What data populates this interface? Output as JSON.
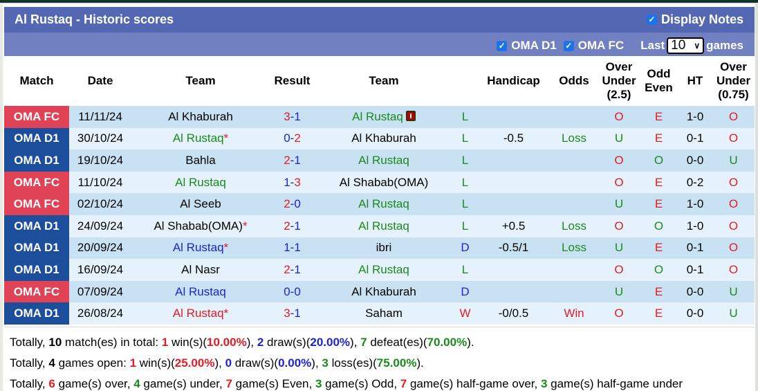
{
  "header": {
    "title": "Al Rustaq - Historic scores",
    "display_notes_label": "Display Notes",
    "display_notes_checked": true
  },
  "filters": {
    "league1_label": "OMA D1",
    "league1_checked": true,
    "league2_label": "OMA FC",
    "league2_checked": true,
    "last_label": "Last",
    "last_value": "10",
    "games_label": "games"
  },
  "columns": [
    "Match",
    "Date",
    "Team",
    "Result",
    "Team",
    "",
    "Handicap",
    "Odds",
    "Over Under (2.5)",
    "Odd Even",
    "HT",
    "Over Under (0.75)"
  ],
  "column_lines": {
    "ou25": [
      "Over",
      "Under",
      "(2.5)"
    ],
    "oe": [
      "Odd",
      "Even"
    ],
    "ou075": [
      "Over",
      "Under",
      "(0.75)"
    ]
  },
  "colors": {
    "title_bar": "#5467b2",
    "filter_bar": "#7080c0",
    "oma_fc": "#df4355",
    "oma_d1": "#1c4e9c",
    "row_odd": "#c8e1f3",
    "row_even": "#e5f2fb",
    "red": "#e31b23",
    "blue": "#1c23d1",
    "green": "#1a8a1a"
  },
  "rows": [
    {
      "league": "OMA FC",
      "date": "11/11/24",
      "home": "Al Rustaq",
      "home_display": "Al Khaburah",
      "home_color": "black",
      "home_star": false,
      "score_home": "3",
      "score_away": "1",
      "sh_color": "red",
      "sa_color": "blue",
      "away": "Al Rustaq",
      "away_color": "green",
      "away_star": false,
      "red_card": true,
      "wdl": "L",
      "wdl_color": "green",
      "handicap": "",
      "odds": "",
      "odds_color": "green",
      "ou": "O",
      "ou_color": "red",
      "oe": "E",
      "oe_color": "red",
      "ht": "1-0",
      "ou075": "O",
      "ou075_color": "red"
    },
    {
      "league": "OMA D1",
      "date": "30/10/24",
      "home_display": "Al Rustaq",
      "home_color": "green",
      "home_star": true,
      "score_home": "0",
      "score_away": "2",
      "sh_color": "blue",
      "sa_color": "red",
      "away": "Al Khaburah",
      "away_color": "black",
      "away_star": false,
      "red_card": false,
      "wdl": "L",
      "wdl_color": "green",
      "handicap": "-0.5",
      "odds": "Loss",
      "odds_color": "green",
      "ou": "U",
      "ou_color": "green",
      "oe": "E",
      "oe_color": "red",
      "ht": "0-1",
      "ou075": "O",
      "ou075_color": "red"
    },
    {
      "league": "OMA D1",
      "date": "19/10/24",
      "home_display": "Bahla",
      "home_color": "black",
      "home_star": false,
      "score_home": "2",
      "score_away": "1",
      "sh_color": "red",
      "sa_color": "blue",
      "away": "Al Rustaq",
      "away_color": "green",
      "away_star": false,
      "red_card": false,
      "wdl": "L",
      "wdl_color": "green",
      "handicap": "",
      "odds": "",
      "odds_color": "green",
      "ou": "O",
      "ou_color": "red",
      "oe": "O",
      "oe_color": "green",
      "ht": "0-0",
      "ou075": "U",
      "ou075_color": "green"
    },
    {
      "league": "OMA FC",
      "date": "11/10/24",
      "home_display": "Al Rustaq",
      "home_color": "green",
      "home_star": false,
      "score_home": "1",
      "score_away": "3",
      "sh_color": "blue",
      "sa_color": "red",
      "away": "Al Shabab(OMA)",
      "away_color": "black",
      "away_star": false,
      "red_card": false,
      "wdl": "L",
      "wdl_color": "green",
      "handicap": "",
      "odds": "",
      "odds_color": "green",
      "ou": "O",
      "ou_color": "red",
      "oe": "E",
      "oe_color": "red",
      "ht": "0-2",
      "ou075": "O",
      "ou075_color": "red"
    },
    {
      "league": "OMA FC",
      "date": "02/10/24",
      "home_display": "Al Seeb",
      "home_color": "black",
      "home_star": false,
      "score_home": "2",
      "score_away": "0",
      "sh_color": "red",
      "sa_color": "blue",
      "away": "Al Rustaq",
      "away_color": "green",
      "away_star": false,
      "red_card": false,
      "wdl": "L",
      "wdl_color": "green",
      "handicap": "",
      "odds": "",
      "odds_color": "green",
      "ou": "U",
      "ou_color": "green",
      "oe": "E",
      "oe_color": "red",
      "ht": "1-0",
      "ou075": "O",
      "ou075_color": "red"
    },
    {
      "league": "OMA D1",
      "date": "24/09/24",
      "home_display": "Al Shabab(OMA)",
      "home_color": "black",
      "home_star": true,
      "score_home": "2",
      "score_away": "1",
      "sh_color": "red",
      "sa_color": "blue",
      "away": "Al Rustaq",
      "away_color": "green",
      "away_star": false,
      "red_card": false,
      "wdl": "L",
      "wdl_color": "green",
      "handicap": "+0.5",
      "odds": "Loss",
      "odds_color": "green",
      "ou": "O",
      "ou_color": "red",
      "oe": "O",
      "oe_color": "green",
      "ht": "1-0",
      "ou075": "O",
      "ou075_color": "red"
    },
    {
      "league": "OMA D1",
      "date": "20/09/24",
      "home_display": "Al Rustaq",
      "home_color": "blue",
      "home_star": true,
      "score_home": "1",
      "score_away": "1",
      "sh_color": "blue",
      "sa_color": "blue",
      "away": "ibri",
      "away_color": "black",
      "away_star": false,
      "red_card": false,
      "wdl": "D",
      "wdl_color": "blue",
      "handicap": "-0.5/1",
      "odds": "Loss",
      "odds_color": "green",
      "ou": "U",
      "ou_color": "green",
      "oe": "E",
      "oe_color": "red",
      "ht": "0-1",
      "ou075": "O",
      "ou075_color": "red"
    },
    {
      "league": "OMA D1",
      "date": "16/09/24",
      "home_display": "Al Nasr",
      "home_color": "black",
      "home_star": false,
      "score_home": "2",
      "score_away": "1",
      "sh_color": "red",
      "sa_color": "blue",
      "away": "Al Rustaq",
      "away_color": "green",
      "away_star": false,
      "red_card": false,
      "wdl": "L",
      "wdl_color": "green",
      "handicap": "",
      "odds": "",
      "odds_color": "green",
      "ou": "O",
      "ou_color": "red",
      "oe": "O",
      "oe_color": "green",
      "ht": "0-1",
      "ou075": "O",
      "ou075_color": "red"
    },
    {
      "league": "OMA FC",
      "date": "07/09/24",
      "home_display": "Al Rustaq",
      "home_color": "blue",
      "home_star": false,
      "score_home": "0",
      "score_away": "0",
      "sh_color": "blue",
      "sa_color": "blue",
      "away": "Al Khaburah",
      "away_color": "black",
      "away_star": false,
      "red_card": false,
      "wdl": "D",
      "wdl_color": "blue",
      "handicap": "",
      "odds": "",
      "odds_color": "green",
      "ou": "U",
      "ou_color": "green",
      "oe": "E",
      "oe_color": "red",
      "ht": "0-0",
      "ou075": "U",
      "ou075_color": "green"
    },
    {
      "league": "OMA D1",
      "date": "26/08/24",
      "home_display": "Al Rustaq",
      "home_color": "red",
      "home_star": true,
      "score_home": "3",
      "score_away": "1",
      "sh_color": "red",
      "sa_color": "blue",
      "away": "Saham",
      "away_color": "black",
      "away_star": false,
      "red_card": false,
      "wdl": "W",
      "wdl_color": "red",
      "handicap": "-0/0.5",
      "odds": "Win",
      "odds_color": "red",
      "ou": "O",
      "ou_color": "red",
      "oe": "E",
      "oe_color": "red",
      "ht": "0-0",
      "ou075": "U",
      "ou075_color": "green"
    }
  ],
  "summary": {
    "line1": [
      {
        "t": "Totally, ",
        "c": "black",
        "b": false
      },
      {
        "t": "10",
        "c": "black",
        "b": true
      },
      {
        "t": " match(es) in total: ",
        "c": "black",
        "b": false
      },
      {
        "t": "1",
        "c": "red",
        "b": true
      },
      {
        "t": " win(s)(",
        "c": "black",
        "b": false
      },
      {
        "t": "10.00%",
        "c": "red",
        "b": true
      },
      {
        "t": "), ",
        "c": "black",
        "b": false
      },
      {
        "t": "2",
        "c": "blue",
        "b": true
      },
      {
        "t": " draw(s)(",
        "c": "black",
        "b": false
      },
      {
        "t": "20.00%",
        "c": "blue",
        "b": true
      },
      {
        "t": "), ",
        "c": "black",
        "b": false
      },
      {
        "t": "7",
        "c": "green",
        "b": true
      },
      {
        "t": " defeat(es)(",
        "c": "black",
        "b": false
      },
      {
        "t": "70.00%",
        "c": "green",
        "b": true
      },
      {
        "t": ").",
        "c": "black",
        "b": false
      }
    ],
    "line2": [
      {
        "t": "Totally, ",
        "c": "black",
        "b": false
      },
      {
        "t": "4",
        "c": "black",
        "b": true
      },
      {
        "t": " games open: ",
        "c": "black",
        "b": false
      },
      {
        "t": "1",
        "c": "red",
        "b": true
      },
      {
        "t": " win(s)(",
        "c": "black",
        "b": false
      },
      {
        "t": "25.00%",
        "c": "red",
        "b": true
      },
      {
        "t": "), ",
        "c": "black",
        "b": false
      },
      {
        "t": "0",
        "c": "blue",
        "b": true
      },
      {
        "t": " draw(s)(",
        "c": "black",
        "b": false
      },
      {
        "t": "0.00%",
        "c": "blue",
        "b": true
      },
      {
        "t": "), ",
        "c": "black",
        "b": false
      },
      {
        "t": "3",
        "c": "green",
        "b": true
      },
      {
        "t": " loss(es)(",
        "c": "black",
        "b": false
      },
      {
        "t": "75.00%",
        "c": "green",
        "b": true
      },
      {
        "t": ").",
        "c": "black",
        "b": false
      }
    ],
    "line3": [
      {
        "t": "Totally, ",
        "c": "black",
        "b": false
      },
      {
        "t": "6",
        "c": "red",
        "b": true
      },
      {
        "t": " game(s) over, ",
        "c": "black",
        "b": false
      },
      {
        "t": "4",
        "c": "green",
        "b": true
      },
      {
        "t": " game(s) under, ",
        "c": "black",
        "b": false
      },
      {
        "t": "7",
        "c": "red",
        "b": true
      },
      {
        "t": " game(s) Even, ",
        "c": "black",
        "b": false
      },
      {
        "t": "3",
        "c": "green",
        "b": true
      },
      {
        "t": " game(s) Odd, ",
        "c": "black",
        "b": false
      },
      {
        "t": "7",
        "c": "red",
        "b": true
      },
      {
        "t": " game(s) half-game over, ",
        "c": "black",
        "b": false
      },
      {
        "t": "3",
        "c": "green",
        "b": true
      },
      {
        "t": " game(s) half-game under",
        "c": "black",
        "b": false
      }
    ]
  }
}
